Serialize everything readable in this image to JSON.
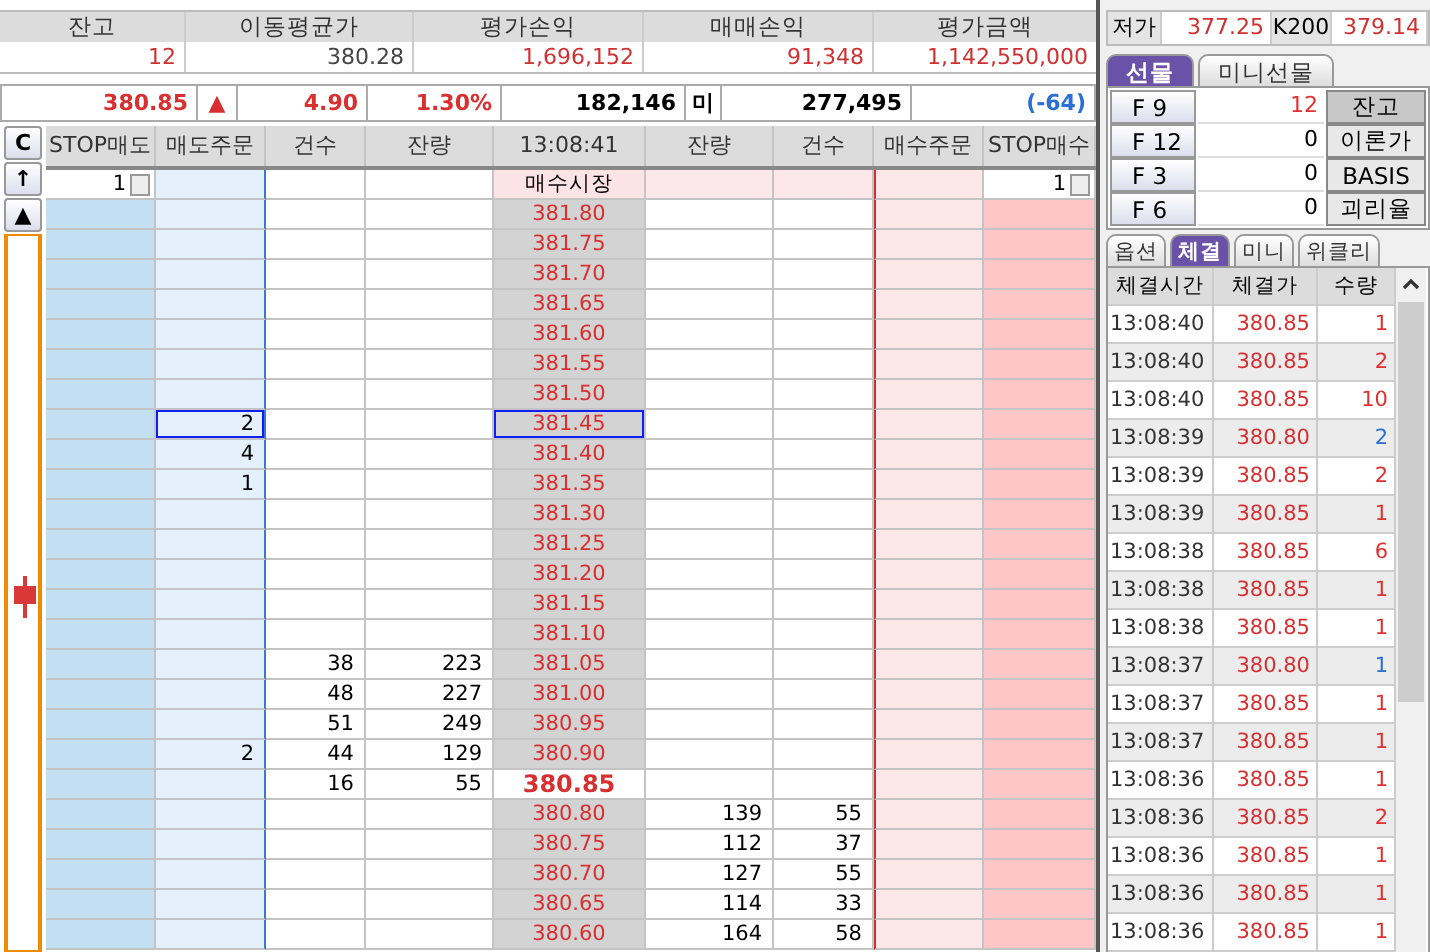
{
  "summary": [
    {
      "label": "잔고",
      "value": "12"
    },
    {
      "label": "이동평균가",
      "value": "380.28"
    },
    {
      "label": "평가손익",
      "value": "1,696,152"
    },
    {
      "label": "매매손익",
      "value": "91,348"
    },
    {
      "label": "평가금액",
      "value": "1,142,550,000"
    }
  ],
  "quote": {
    "price": "380.85",
    "arrow": "▲",
    "change": "4.90",
    "rate": "1.30%",
    "volume": "182,146",
    "unit": "미",
    "open_interest": "277,495",
    "diff": "(-64)"
  },
  "orderbook": {
    "clear_button": "C",
    "up_button": "↑",
    "top_button": "▲",
    "columns": [
      "STOP매도",
      "매도주문",
      "건수",
      "잔량",
      "13:08:41",
      "잔량",
      "건수",
      "매수주문",
      "STOP매수"
    ],
    "rows": [
      {
        "kind": "control",
        "stop_sell": "1",
        "label": "매수시장",
        "stop_buy": "1"
      },
      {
        "kind": "price",
        "price": "381.80",
        "selected": false,
        "current": false
      },
      {
        "kind": "price",
        "price": "381.75",
        "selected": false,
        "current": false
      },
      {
        "kind": "price",
        "price": "381.70",
        "selected": false,
        "current": false
      },
      {
        "kind": "price",
        "price": "381.65",
        "selected": false,
        "current": false
      },
      {
        "kind": "price",
        "price": "381.60",
        "selected": false,
        "current": false
      },
      {
        "kind": "price",
        "price": "381.55",
        "selected": false,
        "current": false
      },
      {
        "kind": "price",
        "price": "381.50",
        "selected": false,
        "current": false
      },
      {
        "kind": "price",
        "price": "381.45",
        "sell_order": "2",
        "selected": true,
        "current": false
      },
      {
        "kind": "price",
        "price": "381.40",
        "sell_order": "4",
        "selected": false,
        "current": false
      },
      {
        "kind": "price",
        "price": "381.35",
        "sell_order": "1",
        "selected": false,
        "current": false
      },
      {
        "kind": "price",
        "price": "381.30",
        "selected": false,
        "current": false
      },
      {
        "kind": "price",
        "price": "381.25",
        "selected": false,
        "current": false
      },
      {
        "kind": "price",
        "price": "381.20",
        "selected": false,
        "current": false
      },
      {
        "kind": "price",
        "price": "381.15",
        "selected": false,
        "current": false
      },
      {
        "kind": "price",
        "price": "381.10",
        "selected": false,
        "current": false
      },
      {
        "kind": "price",
        "price": "381.05",
        "sell_count": "38",
        "sell_qty": "223",
        "selected": false,
        "current": false
      },
      {
        "kind": "price",
        "price": "381.00",
        "sell_count": "48",
        "sell_qty": "227",
        "selected": false,
        "current": false
      },
      {
        "kind": "price",
        "price": "380.95",
        "sell_count": "51",
        "sell_qty": "249",
        "selected": false,
        "current": false
      },
      {
        "kind": "price",
        "price": "380.90",
        "sell_order": "2",
        "sell_count": "44",
        "sell_qty": "129",
        "selected": false,
        "current": false
      },
      {
        "kind": "price",
        "price": "380.85",
        "sell_count": "16",
        "sell_qty": "55",
        "selected": false,
        "current": true
      },
      {
        "kind": "price",
        "price": "380.80",
        "buy_qty": "139",
        "buy_count": "55",
        "selected": false,
        "current": false
      },
      {
        "kind": "price",
        "price": "380.75",
        "buy_qty": "112",
        "buy_count": "37",
        "selected": false,
        "current": false
      },
      {
        "kind": "price",
        "price": "380.70",
        "buy_qty": "127",
        "buy_count": "55",
        "selected": false,
        "current": false
      },
      {
        "kind": "price",
        "price": "380.65",
        "buy_qty": "114",
        "buy_count": "33",
        "selected": false,
        "current": false
      },
      {
        "kind": "price",
        "price": "380.60",
        "buy_qty": "164",
        "buy_count": "58",
        "selected": false,
        "current": false
      }
    ]
  },
  "market_info": [
    {
      "label": "저가",
      "value": "377.25"
    },
    {
      "label": "K200",
      "value": "379.14"
    }
  ],
  "futures_tabs": [
    {
      "label": "선물",
      "selected": true
    },
    {
      "label": "미니선물",
      "selected": false
    }
  ],
  "futures": [
    {
      "code": "F 9",
      "value": "12",
      "color": "#e03030",
      "button": "잔고"
    },
    {
      "code": "F 12",
      "value": "0",
      "color": "#000000",
      "button": "이론가"
    },
    {
      "code": "F 3",
      "value": "0",
      "color": "#000000",
      "button": "BASIS"
    },
    {
      "code": "F 6",
      "value": "0",
      "color": "#000000",
      "button": "괴리율"
    }
  ],
  "trade_tabs": [
    {
      "label": "옵션",
      "selected": false
    },
    {
      "label": "체결",
      "selected": true
    },
    {
      "label": "미니",
      "selected": false
    },
    {
      "label": "위클리",
      "selected": false
    }
  ],
  "trades": {
    "columns": [
      "체결시간",
      "체결가",
      "수량"
    ],
    "rows": [
      {
        "time": "13:08:40",
        "price": "380.85",
        "qty": "1",
        "color": "#e03030"
      },
      {
        "time": "13:08:40",
        "price": "380.85",
        "qty": "2",
        "color": "#e03030"
      },
      {
        "time": "13:08:40",
        "price": "380.85",
        "qty": "10",
        "color": "#e03030"
      },
      {
        "time": "13:08:39",
        "price": "380.80",
        "qty": "2",
        "color": "#2a6fd6"
      },
      {
        "time": "13:08:39",
        "price": "380.85",
        "qty": "2",
        "color": "#e03030"
      },
      {
        "time": "13:08:39",
        "price": "380.85",
        "qty": "1",
        "color": "#e03030"
      },
      {
        "time": "13:08:38",
        "price": "380.85",
        "qty": "6",
        "color": "#e03030"
      },
      {
        "time": "13:08:38",
        "price": "380.85",
        "qty": "1",
        "color": "#e03030"
      },
      {
        "time": "13:08:38",
        "price": "380.85",
        "qty": "1",
        "color": "#e03030"
      },
      {
        "time": "13:08:37",
        "price": "380.80",
        "qty": "1",
        "color": "#2a6fd6"
      },
      {
        "time": "13:08:37",
        "price": "380.85",
        "qty": "1",
        "color": "#e03030"
      },
      {
        "time": "13:08:37",
        "price": "380.85",
        "qty": "1",
        "color": "#e03030"
      },
      {
        "time": "13:08:36",
        "price": "380.85",
        "qty": "1",
        "color": "#e03030"
      },
      {
        "time": "13:08:36",
        "price": "380.85",
        "qty": "2",
        "color": "#e03030"
      },
      {
        "time": "13:08:36",
        "price": "380.85",
        "qty": "1",
        "color": "#e03030"
      },
      {
        "time": "13:08:36",
        "price": "380.85",
        "qty": "1",
        "color": "#e03030"
      },
      {
        "time": "13:08:36",
        "price": "380.85",
        "qty": "1",
        "color": "#e03030"
      }
    ]
  }
}
